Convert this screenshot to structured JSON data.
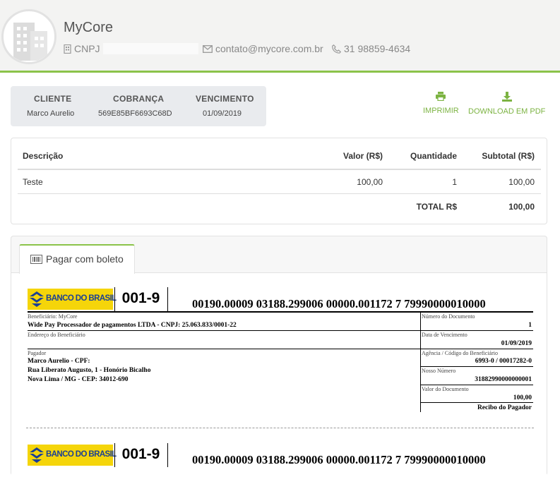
{
  "header": {
    "company_name": "MyCore",
    "cnpj_label": "CNPJ",
    "email": "contato@mycore.com.br",
    "phone": "31 98859-4634"
  },
  "summary": {
    "client_label": "CLIENTE",
    "client_value": "Marco Aurelio",
    "charge_label": "COBRANÇA",
    "charge_value": "569E85BF6693C68D",
    "due_label": "VENCIMENTO",
    "due_value": "01/09/2019"
  },
  "actions": {
    "print_label": "IMPRIMIR",
    "pdf_label": "DOWNLOAD EM PDF",
    "accent_color": "#7cb342"
  },
  "items_table": {
    "headers": [
      "Descrição",
      "Valor (R$)",
      "Quantidade",
      "Subtotal (R$)"
    ],
    "rows": [
      {
        "description": "Teste",
        "value": "100,00",
        "quantity": "1",
        "subtotal": "100,00"
      }
    ],
    "total_label": "TOTAL R$",
    "total_value": "100,00"
  },
  "payment": {
    "tab_label": "Pagar com boleto",
    "tab_icon": "barcode-icon"
  },
  "boleto": {
    "bank_name": "BANCO DO BRASIL",
    "bank_code": "001-9",
    "digitable_line": "00190.00009 03188.299006 00000.001172 7 79990000010000",
    "beneficiary_label": "Beneficiário: MyCore",
    "beneficiary_value": "Wide Pay Processador de pagamentos LTDA - CNPJ: 25.063.833/0001-22",
    "beneficiary_address_label": "Endereço do Beneficiário",
    "payer_label": "Pagador",
    "payer_line1": "Marco Aurelio - CPF:",
    "payer_line2": "Rua Liberato Augusto, 1 - Honório Bicalho",
    "payer_line3": "Nova Lima / MG - CEP: 34012-690",
    "doc_number_label": "Número do Documento",
    "doc_number_value": "1",
    "due_date_label": "Data de Vencimento",
    "due_date_value": "01/09/2019",
    "agency_label": "Agência / Código do Beneficiário",
    "agency_value": "6993-0 / 00017282-0",
    "our_number_label": "Nosso Número",
    "our_number_value": "31882990000000001",
    "doc_value_label": "Valor do Documento",
    "doc_value_value": "100,00",
    "receipt_label": "Recibo do Pagador"
  }
}
